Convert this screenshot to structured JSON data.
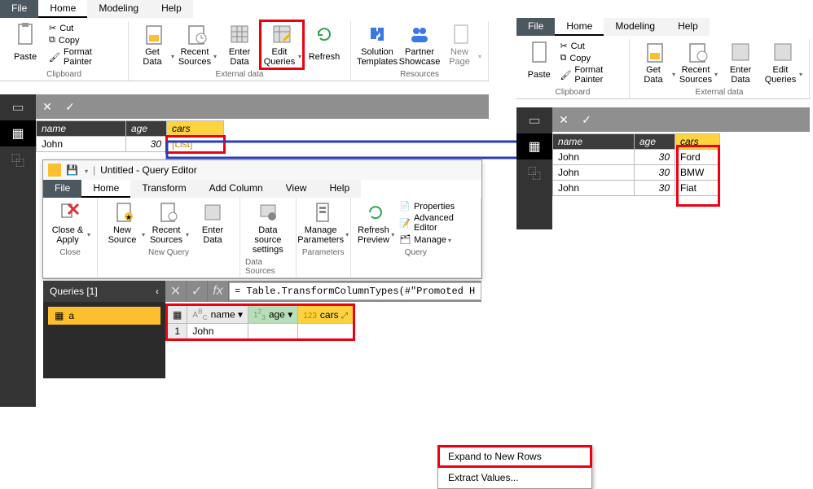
{
  "main": {
    "menu": {
      "file": "File",
      "home": "Home",
      "modeling": "Modeling",
      "help": "Help"
    },
    "clipboard": {
      "paste": "Paste",
      "cut": "Cut",
      "copy": "Copy",
      "fmt": "Format Painter",
      "group": "Clipboard"
    },
    "ext": {
      "get": "Get Data",
      "recent": "Recent Sources",
      "enter": "Enter Data",
      "edit": "Edit Queries",
      "refresh": "Refresh",
      "group": "External data"
    },
    "res": {
      "sol": "Solution Templates",
      "partner": "Partner Showcase",
      "page": "New Page",
      "group": "Resources"
    },
    "cols": {
      "name": "name",
      "age": "age",
      "cars": "cars"
    },
    "row": {
      "name": "John",
      "age": "30",
      "cars": "[List]"
    }
  },
  "right": {
    "rows": [
      {
        "name": "John",
        "age": "30",
        "car": "Ford"
      },
      {
        "name": "John",
        "age": "30",
        "car": "BMW"
      },
      {
        "name": "John",
        "age": "30",
        "car": "Fiat"
      }
    ]
  },
  "qe": {
    "title": "Untitled - Query Editor",
    "menu": {
      "file": "File",
      "home": "Home",
      "transform": "Transform",
      "add": "Add Column",
      "view": "View",
      "help": "Help"
    },
    "groups": {
      "close": "Close & Apply",
      "new": "New Source",
      "recent": "Recent Sources",
      "enter": "Enter Data",
      "ds": "Data source settings",
      "params": "Manage Parameters",
      "refresh": "Refresh Preview",
      "props": "Properties",
      "adv": "Advanced Editor",
      "manage": "Manage",
      "g1": "Close",
      "g2": "New Query",
      "g3": "Data Sources",
      "g4": "Parameters",
      "g5": "Query"
    },
    "queries": "Queries [1]",
    "qname": "a",
    "formula": "= Table.TransformColumnTypes(#\"Promoted H",
    "grid": {
      "name": "name",
      "age": "age",
      "cars": "cars",
      "row1": "John"
    },
    "menuitems": {
      "expand": "Expand to New Rows",
      "extract": "Extract Values..."
    }
  }
}
